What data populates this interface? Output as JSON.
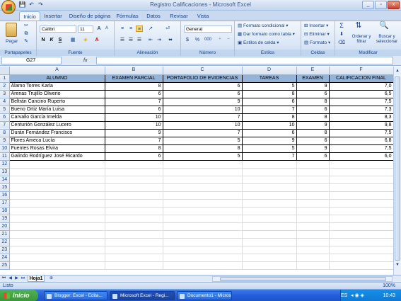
{
  "window": {
    "title": "Registro Calificaciones - Microsoft Excel",
    "controls": [
      "_",
      "▫",
      "x"
    ]
  },
  "qat": {
    "save": "💾",
    "undo": "↶",
    "redo": "↷"
  },
  "tabs": [
    "Inicio",
    "Insertar",
    "Diseño de página",
    "Fórmulas",
    "Datos",
    "Revisar",
    "Vista"
  ],
  "ribbon": {
    "groups": [
      "Portapapeles",
      "Fuente",
      "Alineación",
      "Número",
      "Estilos",
      "Celdas",
      "Modificar"
    ],
    "paste_label": "Pegar",
    "font_name": "Calibri",
    "font_size": "11",
    "number_format": "General",
    "styles": [
      "Formato condicional",
      "Dar formato como tabla",
      "Estilos de celda"
    ],
    "cells": [
      "Insertar",
      "Eliminar",
      "Formato"
    ],
    "edit": [
      "Ordenar y filtrar",
      "Buscar y seleccionar"
    ],
    "font_buttons": [
      "N",
      "K",
      "S"
    ],
    "grow": "A",
    "shrink": "A",
    "percent": "%",
    "thousands": "000",
    "sigma": "Σ"
  },
  "formula_bar": {
    "name_box": "G27",
    "fx": "fx",
    "value": ""
  },
  "columns": [
    "A",
    "B",
    "C",
    "D",
    "E",
    "F"
  ],
  "headers": [
    "ALUMNO",
    "EXAMEN PARCIAL",
    "PORTAFOLIO DE EVIDENCIAS",
    "TAREAS",
    "EXAMEN",
    "CALIFICACION FINAL"
  ],
  "rows": [
    [
      "Álamo Torres Karla",
      "8",
      "6",
      "5",
      "9",
      "7,0"
    ],
    [
      "Arenas Trujillo Oliverio",
      "6",
      "6",
      "8",
      "6",
      "6,5"
    ],
    [
      "Beltrán Cancino Ruperto",
      "7",
      "9",
      "6",
      "8",
      "7,5"
    ],
    [
      "Bueno Ortiz María Luisa",
      "6",
      "10",
      "7",
      "6",
      "7,3"
    ],
    [
      "Carvallo García Imelda",
      "10",
      "7",
      "8",
      "8",
      "8,3"
    ],
    [
      "Centurión González Lucero",
      "10",
      "10",
      "10",
      "9",
      "9,8"
    ],
    [
      "Durán Fernández Francisco",
      "9",
      "7",
      "6",
      "8",
      "7,5"
    ],
    [
      "Flores Ameca Lucía",
      "7",
      "5",
      "9",
      "6",
      "6,8"
    ],
    [
      "Fuentes Rosas Elvira",
      "8",
      "8",
      "5",
      "9",
      "7,5"
    ],
    [
      "Galindo Rodríguez José Ricardo",
      "6",
      "5",
      "7",
      "6",
      "6,0"
    ]
  ],
  "row_numbers": [
    "1",
    "2",
    "3",
    "4",
    "5",
    "6",
    "7",
    "8",
    "9",
    "10",
    "11",
    "12",
    "13",
    "14",
    "15",
    "16",
    "17",
    "18",
    "19",
    "20",
    "21",
    "22",
    "23",
    "24",
    "25"
  ],
  "sheet_tab": "Hoja1",
  "status": {
    "left": "Listo",
    "zoom": "100%"
  },
  "taskbar": {
    "start": "Inicio",
    "tasks": [
      "Blogger: Excel - Edita...",
      "Microsoft Excel - Regi...",
      "Documento1 - Micros..."
    ],
    "tray_lang": "ES",
    "clock": "10:43"
  }
}
